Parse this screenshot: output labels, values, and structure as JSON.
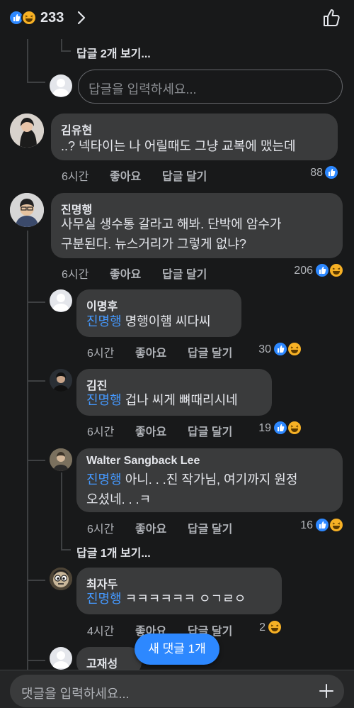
{
  "header": {
    "reaction_count": "233",
    "chevron": "chevron-right-icon",
    "thumb": "thumbs-up-outline-icon"
  },
  "thread": {
    "view_replies_top": "답글 2개 보기...",
    "reply_placeholder": "답글을 입력하세요..."
  },
  "comments": [
    {
      "name": "김유현",
      "text": "..? 넥타이는 나 어릴때도 그냥 교복에 맸는데",
      "time": "6시간",
      "like": "좋아요",
      "reply": "답글 달기",
      "count": "88"
    },
    {
      "name": "진명행",
      "text_line1": "사무실 생수통 갈라고 해봐. 단박에 암수가",
      "text_line2": "구분된다. 뉴스거리가 그렇게 없냐?",
      "time": "6시간",
      "like": "좋아요",
      "reply": "답글 달기",
      "count": "206"
    }
  ],
  "replies": [
    {
      "name": "이명후",
      "mention": "진명행",
      "text": " 명행이햄 씨다씨",
      "time": "6시간",
      "like": "좋아요",
      "reply": "답글 달기",
      "count": "30"
    },
    {
      "name": "김진",
      "mention": "진명행",
      "text": " 겁나 씨게 뼈때리시네",
      "time": "6시간",
      "like": "좋아요",
      "reply": "답글 달기",
      "count": "19"
    },
    {
      "name": "Walter Sangback Lee",
      "mention": "진명행",
      "text_line1": " 아니. . .진 작가님, 여기까지 원정",
      "text_line2": "오셨네. . .ㅋ",
      "time": "6시간",
      "like": "좋아요",
      "reply": "답글 달기",
      "count": "16",
      "view_more": "답글 1개 보기..."
    },
    {
      "name": "최자두",
      "mention": "진명행",
      "text": " ㅋㅋㅋㅋㅋㅋ ㅇㄱㄹㅇ",
      "time": "4시간",
      "like": "좋아요",
      "reply": "답글 달기",
      "count": "2"
    },
    {
      "name": "고재성"
    }
  ],
  "new_comment_pill": "새 댓글 1개",
  "composer": {
    "placeholder": "댓글을 입력하세요...",
    "add_icon": "plus-icon"
  },
  "colors": {
    "background": "#18191a",
    "bubble": "#3a3b3c",
    "accent": "#2d88ff",
    "mention": "#4599ff",
    "secondary_text": "#b0b3b8"
  }
}
